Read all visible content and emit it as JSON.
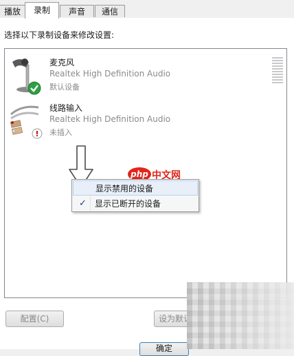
{
  "tabs": [
    {
      "label": "播放"
    },
    {
      "label": "录制"
    },
    {
      "label": "声音"
    },
    {
      "label": "通信"
    }
  ],
  "instruction": "选择以下录制设备来修改设置:",
  "devices": [
    {
      "name": "麦克风",
      "driver": "Realtek High Definition Audio",
      "status": "默认设备",
      "icon": "microphone-icon",
      "badge": "default-check"
    },
    {
      "name": "线路输入",
      "driver": "Realtek High Definition Audio",
      "status": "未插入",
      "icon": "line-in-cable-icon",
      "badge": "unplugged"
    }
  ],
  "context_menu": {
    "items": [
      {
        "label": "显示禁用的设备",
        "checked": false
      },
      {
        "label": "显示已断开的设备",
        "checked": true
      }
    ],
    "check_glyph": "✓"
  },
  "watermark": {
    "logo": "php",
    "text": "中文网"
  },
  "buttons": {
    "configure": "配置(C)",
    "set_default": "设为默认",
    "ok": "确定"
  },
  "colors": {
    "badge_green": "#2ea043",
    "unplugged_red": "#c62828",
    "watermark_red": "#e1251b"
  }
}
